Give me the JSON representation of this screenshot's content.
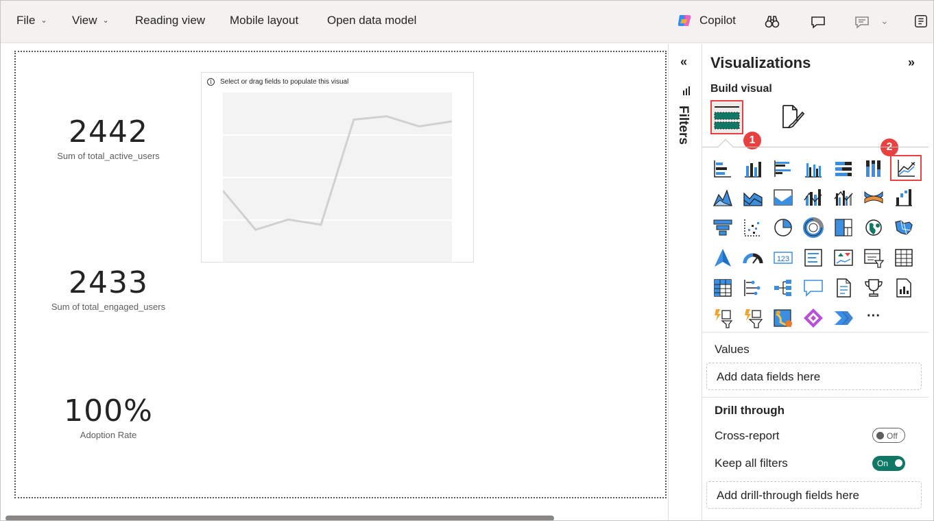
{
  "menubar": {
    "items": [
      {
        "label": "File",
        "has_dropdown": true
      },
      {
        "label": "View",
        "has_dropdown": true
      },
      {
        "label": "Reading view"
      },
      {
        "label": "Mobile layout"
      },
      {
        "label": "Open data model"
      }
    ],
    "copilot_label": "Copilot",
    "icons": [
      "copilot-logo",
      "binoculars-icon",
      "comment-icon",
      "feedback-icon",
      "chevron-down-icon",
      "panel-icon"
    ]
  },
  "canvas": {
    "kpis": [
      {
        "value": "2442",
        "label": "Sum of total_active_users"
      },
      {
        "value": "2433",
        "label": "Sum of total_engaged_users"
      },
      {
        "value": "100%",
        "label": "Adoption Rate"
      }
    ],
    "visual": {
      "hint": "Select or drag fields to populate this visual",
      "placeholder_line": [
        0.42,
        0.19,
        0.25,
        0.22,
        0.84,
        0.86,
        0.8,
        0.83
      ]
    }
  },
  "filters_pane": {
    "label": "Filters",
    "expand_glyph": "«"
  },
  "visualizations": {
    "title": "Visualizations",
    "collapse_glyph": "»",
    "build_label": "Build visual",
    "annotations": [
      {
        "number": "1",
        "target": "build-visual-tab"
      },
      {
        "number": "2",
        "target": "line-chart"
      }
    ],
    "more_glyph": "···",
    "values_label": "Values",
    "values_placeholder": "Add data fields here",
    "drill_through_title": "Drill through",
    "cross_report_label": "Cross-report",
    "cross_report_state": "Off",
    "keep_filters_label": "Keep all filters",
    "keep_filters_state": "On",
    "drill_placeholder": "Add drill-through fields here",
    "colors": {
      "accent": "#117865",
      "highlight": "#e8413f",
      "icon_blue": "#3b8ee0"
    }
  }
}
